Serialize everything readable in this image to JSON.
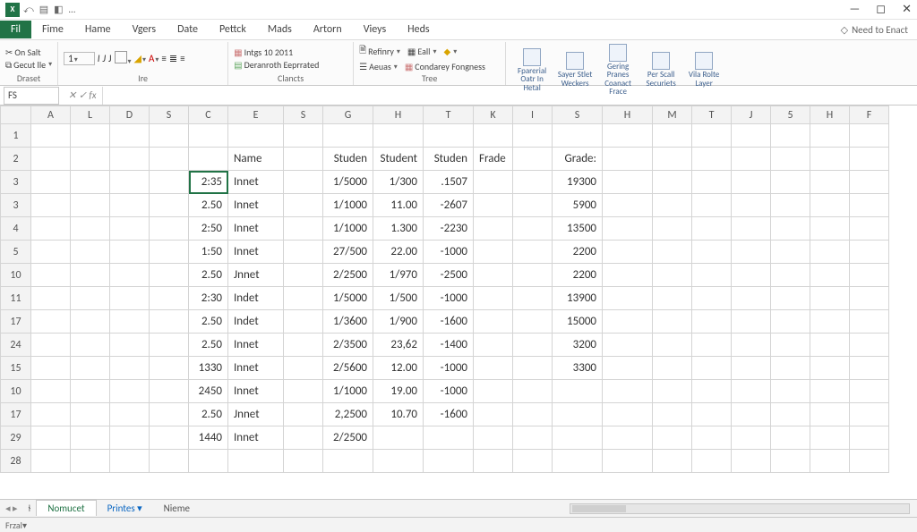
{
  "window": {
    "min": "—",
    "max": "◻",
    "close": "✕"
  },
  "qat": [
    "⤺",
    "▤",
    "◧",
    "…"
  ],
  "tabs": [
    "Fil",
    "Fime",
    "Hame",
    "Vgers",
    "Date",
    "Pettck",
    "Mads",
    "Artorn",
    "Vieys",
    "Heds"
  ],
  "right_help": "Need to Enact",
  "ribbon": {
    "g1": {
      "a": "On Salt",
      "b": "Gecut lle",
      "label": "Draset"
    },
    "g2": {
      "label": "Ire"
    },
    "g3": {
      "a": "Intgs 10 2011",
      "b": "Deranroth Eeprrated",
      "label": "Clancts"
    },
    "g4": {
      "a": "Refinry",
      "b": "Eall",
      "c": "Aeuas",
      "d": "Condarey Fongness",
      "label": "Tree"
    },
    "big": [
      "Fparerial Oatr In Hetal",
      "Sayer Stlet Weckers",
      "Gering Pranes Coanact Frace",
      "Per Scall Securiets",
      "Vila Rolte Layer"
    ]
  },
  "namebox": "FS",
  "columns": [
    "",
    "A",
    "L",
    "D",
    "S",
    "C",
    "E",
    "S",
    "G",
    "H",
    "T",
    "K",
    "I",
    "S",
    "H",
    "M",
    "T",
    "J",
    "5",
    "H",
    "F"
  ],
  "chart_data": {
    "type": "table",
    "headers": {
      "E": "Name",
      "G": "Studen",
      "H": "Student",
      "T": "Studen",
      "K": "Frade",
      "S": "Grade:"
    },
    "rows": [
      {
        "r": "1"
      },
      {
        "r": "2",
        "E": "Name",
        "G": "Studen",
        "H": "Student",
        "T": "Studen",
        "K": "Frade",
        "S": "Grade:"
      },
      {
        "r": "3",
        "C": "2:35",
        "E": "Innet",
        "G": "1/5000",
        "H": "1/300",
        "T": ".1507",
        "S": "19300"
      },
      {
        "r": "3",
        "C": "2.50",
        "E": "Innet",
        "G": "1/1000",
        "H": "11.00",
        "T": "-2607",
        "S": "5900"
      },
      {
        "r": "4",
        "C": "2:50",
        "E": "Innet",
        "G": "1/1000",
        "H": "1.300",
        "T": "-2230",
        "S": "13500"
      },
      {
        "r": "5",
        "C": "1:50",
        "E": "Innet",
        "G": "27/500",
        "H": "22.00",
        "T": "-1000",
        "S": "2200"
      },
      {
        "r": "10",
        "C": "2.50",
        "E": "Jnnet",
        "G": "2/2500",
        "H": "1/970",
        "T": "-2500",
        "S": "2200"
      },
      {
        "r": "11",
        "C": "2:30",
        "E": "Indet",
        "G": "1/5000",
        "H": "1/500",
        "T": "-1000",
        "S": "13900"
      },
      {
        "r": "17",
        "C": "2.50",
        "E": "Indet",
        "G": "1/3600",
        "H": "1/900",
        "T": "-1600",
        "S": "15000"
      },
      {
        "r": "24",
        "C": "2.50",
        "E": "Innet",
        "G": "2/3500",
        "H": "23,62",
        "T": "-1400",
        "S": "3200"
      },
      {
        "r": "15",
        "C": "1330",
        "E": "Innet",
        "G": "2/5600",
        "H": "12.00",
        "T": "-1000",
        "S": "3300"
      },
      {
        "r": "10",
        "C": "2450",
        "E": "Innet",
        "G": "1/1000",
        "H": "19.00",
        "T": "-1000"
      },
      {
        "r": "17",
        "C": "2.50",
        "E": "Jnnet",
        "G": "2,2500",
        "H": "10.70",
        "T": "-1600"
      },
      {
        "r": "29",
        "C": "1440",
        "E": "Innet",
        "G": "2/2500"
      },
      {
        "r": "28"
      }
    ]
  },
  "sheets": {
    "nav": "◂  ▸",
    "s1": "Nomucet",
    "s2": "Printes",
    "s3": "Nieme"
  },
  "status": "Frzal"
}
